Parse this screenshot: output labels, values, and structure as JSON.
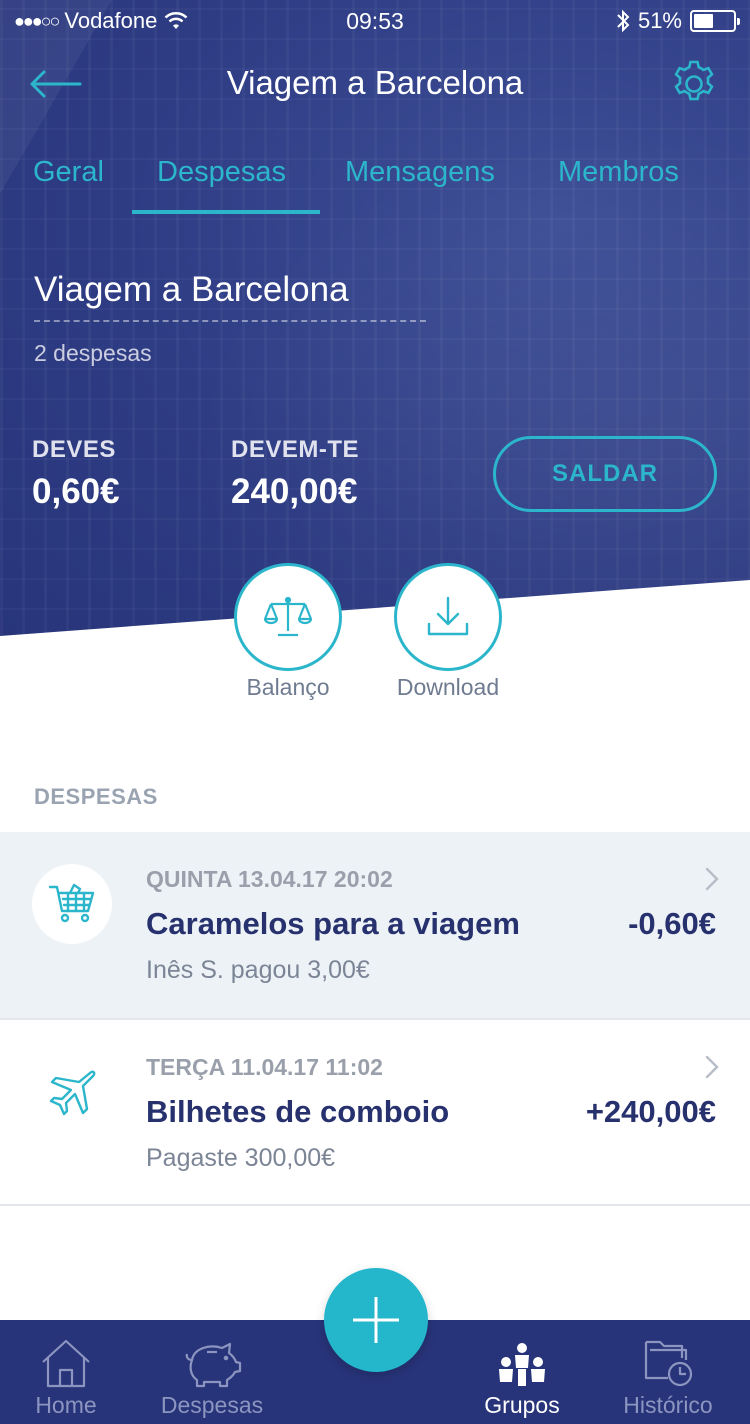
{
  "status_bar": {
    "carrier": "Vodafone",
    "time": "09:53",
    "battery": "51%",
    "battery_level": 0.51
  },
  "nav": {
    "title": "Viagem a Barcelona"
  },
  "tabs": [
    {
      "label": "Geral"
    },
    {
      "label": "Despesas"
    },
    {
      "label": "Mensagens"
    },
    {
      "label": "Membros"
    }
  ],
  "active_tab": "Despesas",
  "group": {
    "name": "Viagem a Barcelona",
    "expense_count": "2 despesas"
  },
  "balance": {
    "owe_label": "DEVES",
    "owe_value": "0,60€",
    "owed_label": "DEVEM-TE",
    "owed_value": "240,00€",
    "settle_label": "SALDAR"
  },
  "actions": {
    "balance_label": "Balanço",
    "download_label": "Download"
  },
  "section_label": "DESPESAS",
  "expenses": [
    {
      "date": "QUINTA 13.04.17 20:02",
      "title": "Caramelos para a viagem",
      "subtitle": "Inês S. pagou 3,00€",
      "amount": "-0,60€",
      "icon": "shopping-cart-icon"
    },
    {
      "date": "TERÇA 11.04.17 11:02",
      "title": "Bilhetes de comboio",
      "subtitle": "Pagaste 300,00€",
      "amount": "+240,00€",
      "icon": "airplane-icon"
    }
  ],
  "tabbar": [
    {
      "label": "Home",
      "icon": "home-icon"
    },
    {
      "label": "Despesas",
      "icon": "piggy-bank-icon"
    },
    {
      "label": "Grupos",
      "icon": "group-icon"
    },
    {
      "label": "Histórico",
      "icon": "history-icon"
    }
  ],
  "active_tabbar": "Grupos",
  "colors": {
    "accent": "#2cb6cb",
    "primary": "#2e3c84",
    "text_dark": "#27316e"
  }
}
